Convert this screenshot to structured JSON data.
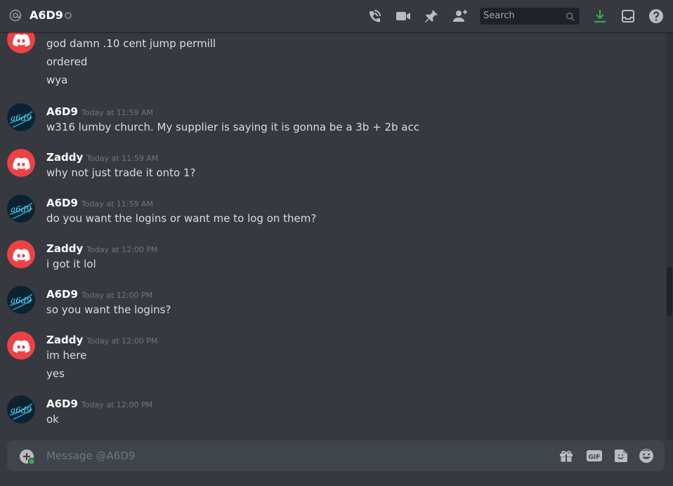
{
  "header": {
    "title": "A6D9",
    "search_placeholder": "Search"
  },
  "icons": {
    "at": "at-sign-icon",
    "call": "phone-call-icon",
    "video": "video-camera-icon",
    "pin": "pin-icon",
    "add_friend": "add-friend-icon",
    "download": "download-icon",
    "inbox": "inbox-icon",
    "help": "help-icon"
  },
  "colors": {
    "background": "#36393f",
    "brand_red": "#ed4245",
    "download_green": "#3ba55c"
  },
  "messages": [
    {
      "author": "",
      "time": "",
      "lines": [
        "god damn .10 cent jump permill",
        "ordered",
        "wya"
      ],
      "avatar": "discord"
    },
    {
      "author": "A6D9",
      "time": "Today at 11:59 AM",
      "lines": [
        "w316 lumby church. My supplier is saying it is gonna be a 3b + 2b acc"
      ],
      "avatar": "a6d9"
    },
    {
      "author": "Zaddy",
      "time": "Today at 11:59 AM",
      "lines": [
        "why not just trade it onto 1?"
      ],
      "avatar": "discord"
    },
    {
      "author": "A6D9",
      "time": "Today at 11:59 AM",
      "lines": [
        "do you want the logins or want me to log on them?"
      ],
      "avatar": "a6d9"
    },
    {
      "author": "Zaddy",
      "time": "Today at 12:00 PM",
      "lines": [
        "i got it lol"
      ],
      "avatar": "discord"
    },
    {
      "author": "A6D9",
      "time": "Today at 12:00 PM",
      "lines": [
        "so you want the logins?"
      ],
      "avatar": "a6d9"
    },
    {
      "author": "Zaddy",
      "time": "Today at 12:00 PM",
      "lines": [
        "im here",
        "yes"
      ],
      "avatar": "discord"
    },
    {
      "author": "A6D9",
      "time": "Today at 12:00 PM",
      "lines": [
        "ok"
      ],
      "avatar": "a6d9"
    }
  ],
  "composer": {
    "placeholder": "Message @A6D9",
    "gif_label": "GIF"
  }
}
